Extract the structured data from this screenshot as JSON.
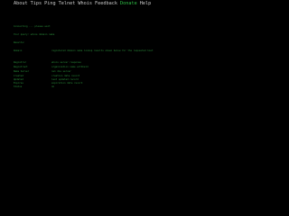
{
  "menu": [
    {
      "label": "About",
      "accent": false
    },
    {
      "label": "Tips",
      "accent": false
    },
    {
      "label": "Ping",
      "accent": false
    },
    {
      "label": "Telnet",
      "accent": false
    },
    {
      "label": "Whois",
      "accent": false
    },
    {
      "label": "Feedback",
      "accent": false
    },
    {
      "label": "Donate",
      "accent": true
    },
    {
      "label": "Help",
      "accent": false
    }
  ],
  "lines": {
    "l1": "Connecting ... please wait",
    "l2": "Your query: whois domain name",
    "l3": "Results:"
  },
  "records": [
    {
      "key": "Domain",
      "value": "registered domain name lookup results shown below for the requested host"
    },
    {
      "key": "Registrar",
      "value": "whois server response"
    },
    {
      "key": "Registrant",
      "value": "organization name withheld"
    },
    {
      "key": "Name Server",
      "value": "ns1 dns server"
    },
    {
      "key": "Created",
      "value": "creation date record"
    },
    {
      "key": "Updated",
      "value": "last updated record"
    },
    {
      "key": "Expires",
      "value": "expiration date record"
    },
    {
      "key": "Status",
      "value": "ok"
    }
  ],
  "colors": {
    "background": "#000000",
    "menu_text": "#c9c9c9",
    "menu_accent": "#2fbf46",
    "terminal_text": "#2a8f3a"
  }
}
